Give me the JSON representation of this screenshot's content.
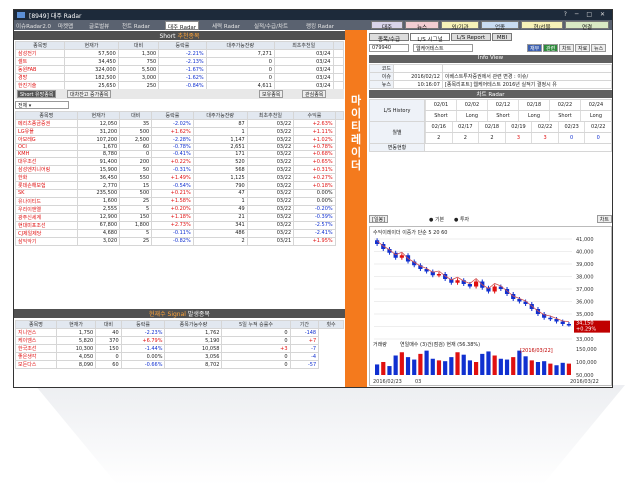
{
  "app": {
    "title": "[8949] 대주 Radar",
    "window_controls": "? ─ □ ✕"
  },
  "main_tabs": [
    "이슈Radar2.0",
    "마켓맵",
    "글로벌뷰",
    "천트 Radar",
    "대주 Radar",
    "세력 Radar",
    "실적/수급/차트",
    "랭킹 Radar"
  ],
  "right_top_tabs": [
    "대주",
    "뉴스",
    "외/기관",
    "업종",
    "현/선물",
    "연결"
  ],
  "short_panel": {
    "title": "Short",
    "title_accent": "추천종목",
    "columns": [
      "종목명",
      "현재가",
      "대비",
      "등락률",
      "대주가능잔량",
      "최초추천일",
      ""
    ],
    "rows": [
      [
        "삼성전기",
        "57,500",
        "1,300",
        "-2.21%",
        "7,271",
        "03/24",
        ""
      ],
      [
        "셀트",
        "34,450",
        "750",
        "-2.13%",
        "0",
        "03/24",
        ""
      ],
      [
        "동원FAB",
        "324,000",
        "5,500",
        "-1.67%",
        "0",
        "03/24",
        ""
      ],
      [
        "경방",
        "182,500",
        "3,000",
        "-1.62%",
        "0",
        "03/24",
        ""
      ],
      [
        "한진기술",
        "25,650",
        "250",
        "-0.84%",
        "4,611",
        "03/24",
        ""
      ]
    ]
  },
  "controls": {
    "short_tabs": [
      "Short 유망종목",
      "대차잔고 증가종목"
    ],
    "buttons": [
      "보유종목",
      "관심종목"
    ],
    "filter": "전체"
  },
  "list": {
    "columns": [
      "종목명",
      "현재가",
      "대비",
      "등락률",
      "대주가능잔량",
      "최초추천일",
      "수익률",
      ""
    ],
    "rows": [
      [
        "메리츠종금증권",
        "12,050",
        "35",
        "-2.02%",
        "87",
        "03/22",
        "+2.63%"
      ],
      [
        "LG유플",
        "31,200",
        "500",
        "+1.62%",
        "1",
        "03/22",
        "+1.11%"
      ],
      [
        "아모레G",
        "107,200",
        "2,500",
        "-2.28%",
        "1,147",
        "03/22",
        "+1.02%"
      ],
      [
        "OCI",
        "1,670",
        "60",
        "-0.78%",
        "2,651",
        "03/22",
        "+0.78%"
      ],
      [
        "KMH",
        "8,780",
        "0",
        "-0.41%",
        "171",
        "03/22",
        "+0.68%"
      ],
      [
        "대우조선",
        "91,400",
        "200",
        "+0.22%",
        "520",
        "03/22",
        "+0.65%"
      ],
      [
        "삼성엔지니어링",
        "15,900",
        "50",
        "-0.31%",
        "568",
        "03/22",
        "+0.31%"
      ],
      [
        "한화",
        "36,450",
        "550",
        "+1.49%",
        "1,125",
        "03/22",
        "+0.27%"
      ],
      [
        "롯데손해보험",
        "2,770",
        "15",
        "-0.54%",
        "790",
        "03/22",
        "+0.18%"
      ],
      [
        "SK",
        "235,500",
        "500",
        "+0.21%",
        "47",
        "03/22",
        "0.00%"
      ],
      [
        "유나이티드",
        "1,600",
        "25",
        "+1.58%",
        "1",
        "03/22",
        "0.00%"
      ],
      [
        "우리이앤엘",
        "2,555",
        "5",
        "+0.20%",
        "49",
        "03/22",
        "-0.20%"
      ],
      [
        "광주신세계",
        "12,900",
        "150",
        "+1.18%",
        "21",
        "03/22",
        "-0.39%"
      ],
      [
        "현대미포조선",
        "67,800",
        "1,800",
        "+2.73%",
        "341",
        "03/22",
        "-2.57%"
      ],
      [
        "CJ제일제당",
        "4,680",
        "5",
        "-0.11%",
        "486",
        "03/22",
        "-2.41%"
      ],
      [
        "삼익악기",
        "3,020",
        "25",
        "-0.82%",
        "2",
        "03/21",
        "+1.95%"
      ]
    ]
  },
  "signal_panel": {
    "title": "현재수",
    "title_accent": "Signal",
    "title_tail": "발생종목",
    "columns": [
      "종목명",
      "현재가",
      "대비",
      "등락률",
      "종목가능수량",
      "5일 누적 승률수",
      "기간",
      "횟수"
    ],
    "rows": [
      [
        "지니언스",
        "1,750",
        "40",
        "-2.23%",
        "1,762",
        "0",
        "-148"
      ],
      [
        "케이엠스",
        "5,820",
        "370",
        "+6.79%",
        "5,190",
        "0",
        "+7"
      ],
      [
        "한국조선",
        "10,300",
        "150",
        "-1.44%",
        "10,058",
        "+3",
        "-7"
      ],
      [
        "좋은생각",
        "4,050",
        "0",
        "0.00%",
        "3,056",
        "0",
        "-4"
      ],
      [
        "모든다스",
        "8,090",
        "60",
        "-0.66%",
        "8,702",
        "0",
        "-57"
      ]
    ]
  },
  "right": {
    "tabs": [
      "종목/수급",
      "L/S 시그널",
      "L/S Report",
      "MBI"
    ],
    "stock_code": "079940",
    "stock_name": "웹케어테스트",
    "small_buttons": [
      "재무",
      "관련",
      "차트",
      "자료",
      "뉴스"
    ],
    "info_title": "Info View",
    "info": [
      [
        "코드",
        "",
        ""
      ],
      [
        "이슈",
        "2016/02/12",
        "이베스트투자증권에서 관련 변경 : 이슈/"
      ],
      [
        "뉴스",
        "10:16:07",
        "[종목리포트] 웹케어테스트 2016년 실적기 결정시 유"
      ]
    ],
    "lsr_title": "차트 Radar",
    "lsr_dates": [
      "02/01",
      "02/02",
      "02/12",
      "02/18",
      "02/22",
      "02/24"
    ],
    "lsr_types": [
      "Short",
      "Long",
      "Short",
      "Long",
      "Short",
      "Long"
    ],
    "week_dates": [
      "02/16",
      "02/17",
      "02/18",
      "02/19",
      "02/22",
      "02/23",
      "02/22"
    ],
    "week_vals": [
      "2",
      "2",
      "2",
      "3",
      "3",
      "0",
      "0"
    ],
    "label_hist": "L/S History",
    "label_week": "월별",
    "label_change": "변동현황"
  },
  "chart": {
    "type": "candlestick",
    "title": "수익이레이더 이중가 단순 5 20 60",
    "legend": [
      "기본",
      "투자"
    ],
    "period_select": "[일봉]",
    "ticks": [
      "41,000",
      "40,000",
      "39,000",
      "38,000",
      "37,000",
      "36,000",
      "35,000",
      "34,000",
      "33,000"
    ],
    "price_labels": [
      "34,150",
      "+0.29%"
    ],
    "vol_label": "거래량",
    "vol_note": "연일매수 (3)건(점검) 현재 (56.38%)",
    "vol_ticks": [
      "150,000",
      "100,000",
      "50,000"
    ],
    "vol_date": "[2016/03/22]",
    "dates": [
      "2016/02/23",
      "03",
      "2016/03/22"
    ],
    "chart_btn": "차트",
    "candles": [
      40.6,
      40.2,
      39.9,
      39.5,
      39.7,
      39.2,
      38.9,
      38.6,
      38.4,
      38.1,
      38.2,
      37.8,
      37.5,
      37.7,
      37.4,
      37.2,
      37.6,
      37.1,
      36.8,
      37.2,
      37.0,
      36.6,
      36.2,
      36.0,
      35.8,
      35.4,
      35.0,
      34.7,
      34.6,
      34.4,
      34.2,
      34.15
    ],
    "volumes": [
      65,
      80,
      55,
      120,
      140,
      110,
      95,
      130,
      150,
      100,
      90,
      85,
      110,
      140,
      125,
      90,
      80,
      130,
      145,
      120,
      100,
      95,
      110,
      150,
      115,
      90,
      80,
      85,
      70,
      60,
      75,
      70
    ]
  }
}
